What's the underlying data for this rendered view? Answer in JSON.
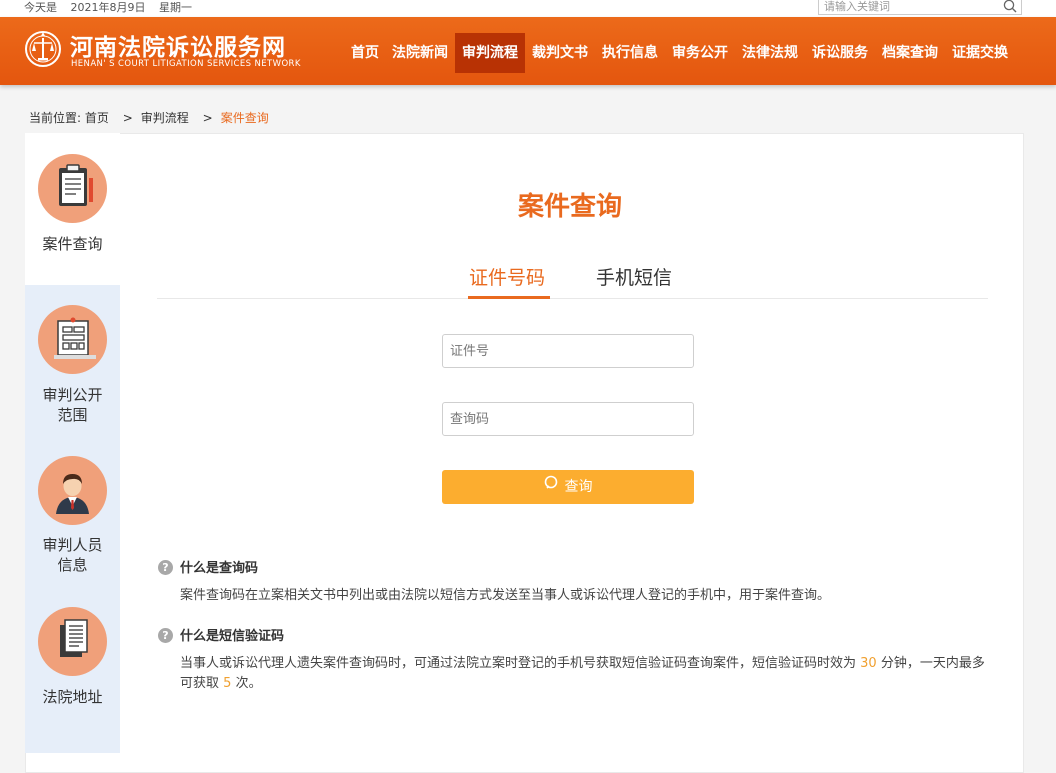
{
  "topbar": {
    "today_label": "今天是",
    "date": "2021年8月9日",
    "weekday": "星期一",
    "search_placeholder": "请输入关键词"
  },
  "header": {
    "site_title": "河南法院诉讼服务网",
    "site_subtitle": "HENAN' S COURT LITIGATION SERVICES NETWORK",
    "nav": [
      {
        "label": "首页"
      },
      {
        "label": "法院新闻"
      },
      {
        "label": "审判流程"
      },
      {
        "label": "裁判文书"
      },
      {
        "label": "执行信息"
      },
      {
        "label": "审务公开"
      },
      {
        "label": "法律法规"
      },
      {
        "label": "诉讼服务"
      },
      {
        "label": "档案查询"
      },
      {
        "label": "证据交换"
      }
    ],
    "active_nav": "审判流程"
  },
  "breadcrumb": {
    "prefix": "当前位置:",
    "items": [
      "首页",
      "审判流程"
    ],
    "separator": ">",
    "current": "案件查询"
  },
  "sidebar": {
    "items": [
      {
        "label": "案件查询",
        "icon": "clipboard-icon",
        "active": true
      },
      {
        "label": "审判公开范围",
        "line1": "审判公开",
        "line2": "范围",
        "icon": "notice-board-icon"
      },
      {
        "label": "审判人员信息",
        "line1": "审判人员",
        "line2": "信息",
        "icon": "judge-avatar-icon"
      },
      {
        "label": "法院地址",
        "icon": "document-stack-icon"
      }
    ]
  },
  "main": {
    "title": "案件查询",
    "tabs": [
      {
        "label": "证件号码",
        "active": true
      },
      {
        "label": "手机短信",
        "active": false
      }
    ],
    "id_placeholder": "证件号",
    "code_placeholder": "查询码",
    "query_button": "查询"
  },
  "faq": [
    {
      "question": "什么是查询码",
      "answer": "案件查询码在立案相关文书中列出或由法院以短信方式发送至当事人或诉讼代理人登记的手机中，用于案件查询。"
    },
    {
      "question": "什么是短信验证码",
      "answer_part1": "当事人或诉讼代理人遗失案件查询码时，可通过法院立案时登记的手机号获取短信验证码查询案件，短信验证码时效为",
      "minutes": "30",
      "answer_part2": "分钟，一天内最多可获取",
      "times": "5",
      "answer_part3": "次。"
    }
  ],
  "colors": {
    "header": "#e4560e",
    "nav_active": "#b83204",
    "accent": "#e96a1f",
    "button": "#fcad2f",
    "sidebar_bg": "#e6eef9",
    "icon_circle": "#f0a07a"
  }
}
